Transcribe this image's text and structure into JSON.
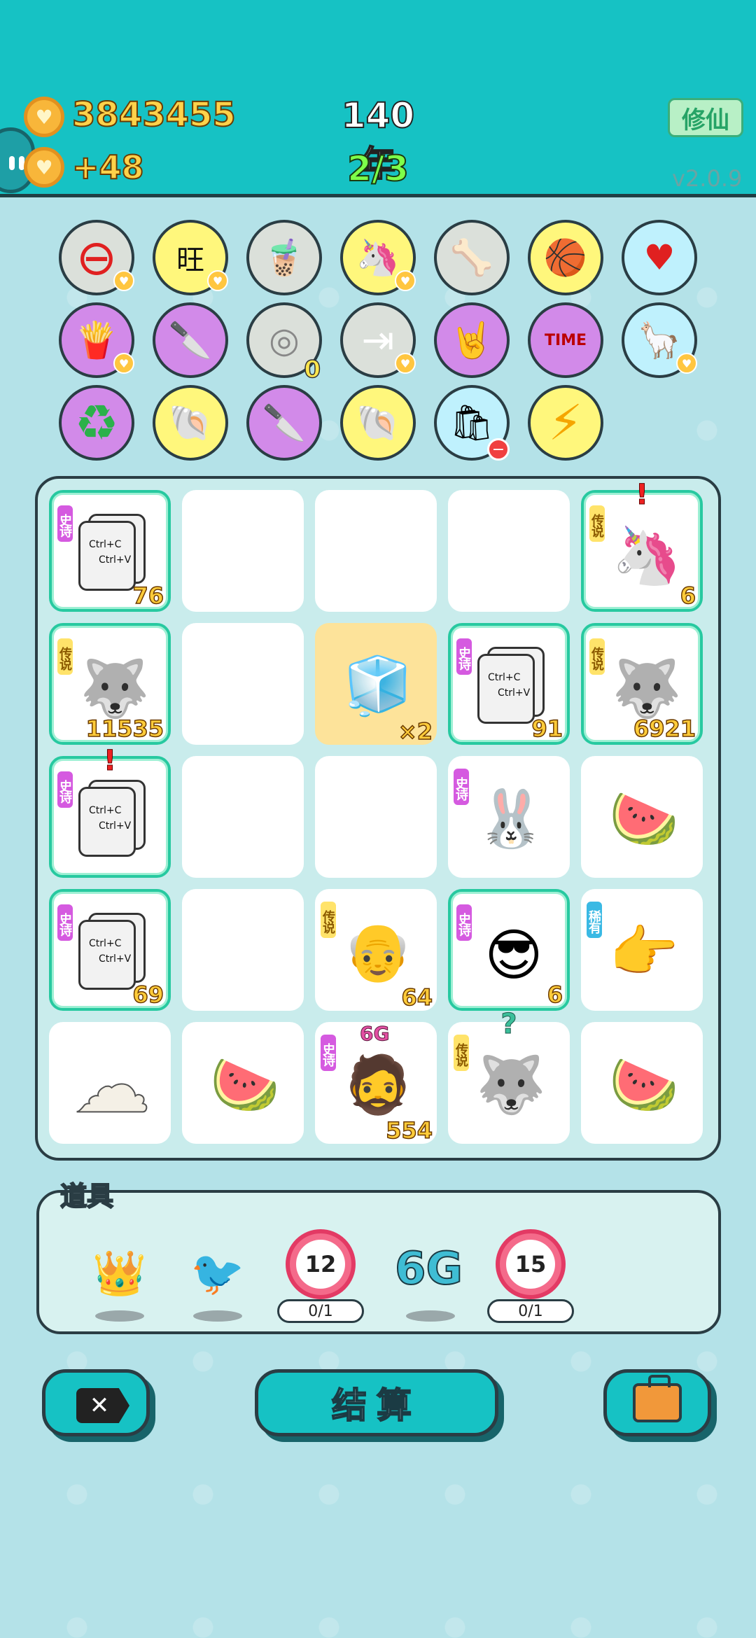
{
  "header": {
    "coins": "3843455",
    "income": "+48",
    "year": "140年",
    "progress": "2/3",
    "xiuxian_button": "修仙",
    "version": "v2.0.9"
  },
  "effects": [
    {
      "icon": "no-entry-icon",
      "glyph": "⊖"
    },
    {
      "icon": "wang-text-icon",
      "glyph": "旺"
    },
    {
      "icon": "bubble-tea-icon",
      "glyph": "🧋"
    },
    {
      "icon": "unicorn-icon",
      "glyph": "🦄"
    },
    {
      "icon": "dog-food-icon",
      "glyph": "🦴"
    },
    {
      "icon": "basketballs-icon",
      "glyph": "🏀"
    },
    {
      "icon": "heart-bag-icon",
      "glyph": "♥"
    },
    {
      "icon": "fries-icon",
      "glyph": "🍟"
    },
    {
      "icon": "cleaver-icon",
      "glyph": "🔪"
    },
    {
      "icon": "egg-tray-icon",
      "glyph": "◎",
      "count": "0"
    },
    {
      "icon": "skip-icon",
      "glyph": "⇥"
    },
    {
      "icon": "rock-hand-icon",
      "glyph": "🤘"
    },
    {
      "icon": "time-magazine-icon",
      "glyph": "TIME"
    },
    {
      "icon": "alpacas-icon",
      "glyph": "🦙"
    },
    {
      "icon": "recycle-icon",
      "glyph": "♻"
    },
    {
      "icon": "shell-icon",
      "glyph": "🐚"
    },
    {
      "icon": "cleaver-icon",
      "glyph": "🔪"
    },
    {
      "icon": "shell-icon",
      "glyph": "🐚"
    },
    {
      "icon": "trash-bag-icon",
      "glyph": "🛍"
    },
    {
      "icon": "lightning-icon",
      "glyph": "⚡"
    }
  ],
  "board": {
    "rarity_labels": {
      "epic": "史诗",
      "legend": "传说",
      "rare": "稀有"
    },
    "cells": [
      {
        "item": "copy-paste",
        "rarity": "epic",
        "count": "76"
      },
      {
        "item": "empty"
      },
      {
        "item": "empty"
      },
      {
        "item": "empty"
      },
      {
        "item": "unicorn",
        "rarity": "legend",
        "count": "6",
        "alert": "!"
      },
      {
        "item": "husky-king",
        "rarity": "legend",
        "count": "11535"
      },
      {
        "item": "empty"
      },
      {
        "item": "fridge",
        "count": "×2",
        "highlight": true
      },
      {
        "item": "copy-paste",
        "rarity": "epic",
        "count": "91"
      },
      {
        "item": "husky-king",
        "rarity": "legend",
        "count": "6921"
      },
      {
        "item": "copy-paste",
        "rarity": "epic",
        "alert": "!"
      },
      {
        "item": "empty"
      },
      {
        "item": "empty"
      },
      {
        "item": "rabbit-house",
        "rarity": "epic"
      },
      {
        "item": "watermelon"
      },
      {
        "item": "copy-paste",
        "rarity": "epic",
        "count": "69"
      },
      {
        "item": "empty"
      },
      {
        "item": "old-man-glasses",
        "rarity": "legend",
        "count": "64"
      },
      {
        "item": "green-hat-man",
        "rarity": "epic",
        "count": "6"
      },
      {
        "item": "pointing-hand",
        "rarity": "rare"
      },
      {
        "item": "cotton"
      },
      {
        "item": "watermelon"
      },
      {
        "item": "bearded-man",
        "rarity": "epic",
        "count": "554",
        "sixg": "6G"
      },
      {
        "item": "husky-king",
        "rarity": "legend",
        "question": "?"
      },
      {
        "item": "watermelon"
      }
    ],
    "copy_text": [
      "Ctrl+C",
      "Ctrl+V"
    ]
  },
  "tools": {
    "label": "道具",
    "items": [
      {
        "icon": "crown-icon",
        "glyph": "👑"
      },
      {
        "icon": "bird-icon",
        "glyph": "🐦"
      },
      {
        "icon": "timer-12-icon",
        "value": "12",
        "cap": "0/1"
      },
      {
        "icon": "six-g-icon",
        "value": "6G"
      },
      {
        "icon": "timer-15-icon",
        "value": "15",
        "cap": "0/1"
      }
    ]
  },
  "buttons": {
    "close_glyph": "✕",
    "settle": "结算"
  },
  "colors": {
    "topbar": "#16c2c4",
    "background": "#b4e2e8",
    "coin": "#ffd24a",
    "epic": "#d55ae0",
    "legend": "#ffe36a",
    "rare": "#3ab9e4"
  }
}
